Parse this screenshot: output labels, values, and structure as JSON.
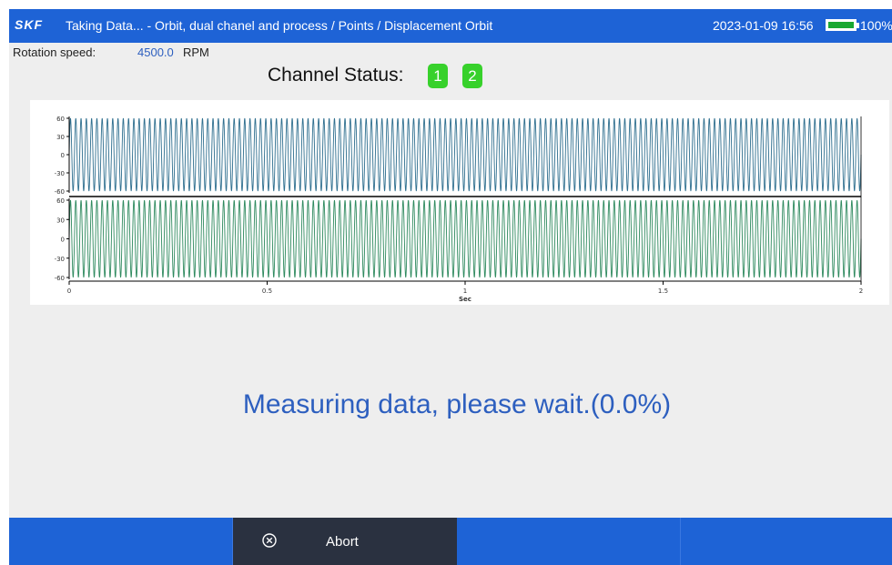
{
  "header": {
    "logo": "SKF",
    "title": "Taking Data... - Orbit, dual chanel and process / Points / Displacement Orbit",
    "datetime": "2023-01-09 16:56",
    "battery_percent": "100%",
    "battery_level": 1.0,
    "battery_color": "#1aa832"
  },
  "rotation": {
    "label": "Rotation speed:",
    "value": "4500.0",
    "unit": "RPM"
  },
  "channel_status": {
    "label": "Channel Status:",
    "channels": [
      {
        "label": "1",
        "status_color": "#37d12b"
      },
      {
        "label": "2",
        "status_color": "#37d12b"
      }
    ]
  },
  "chart_data": {
    "type": "line",
    "xlabel": "Sec",
    "x_ticks": [
      "0",
      "0.5",
      "1",
      "1.5",
      "2"
    ],
    "xlim": [
      0,
      2
    ],
    "grid": false,
    "panels": [
      {
        "name": "",
        "y_ticks": [
          "60",
          "30",
          "0",
          "-30",
          "-60"
        ],
        "ylim": [
          -60,
          60
        ],
        "color": "#2f6f8f",
        "series": {
          "waveform": "sine",
          "amplitude": 60,
          "frequency_hz": 75,
          "duration_s": 2
        }
      },
      {
        "name": "",
        "y_ticks": [
          "60",
          "30",
          "0",
          "-30",
          "-60"
        ],
        "ylim": [
          -60,
          60
        ],
        "color": "#2f8a5f",
        "series": {
          "waveform": "sine",
          "amplitude": 60,
          "frequency_hz": 75,
          "duration_s": 2
        }
      }
    ]
  },
  "status": {
    "message": "Measuring data, please wait.(0.0%)"
  },
  "toolbar": {
    "abort_label": "Abort",
    "abort_icon": "circle-x-icon"
  },
  "colors": {
    "accent": "#1e63d6",
    "text_blue": "#2d5fbf",
    "active_button": "#2a3140"
  }
}
